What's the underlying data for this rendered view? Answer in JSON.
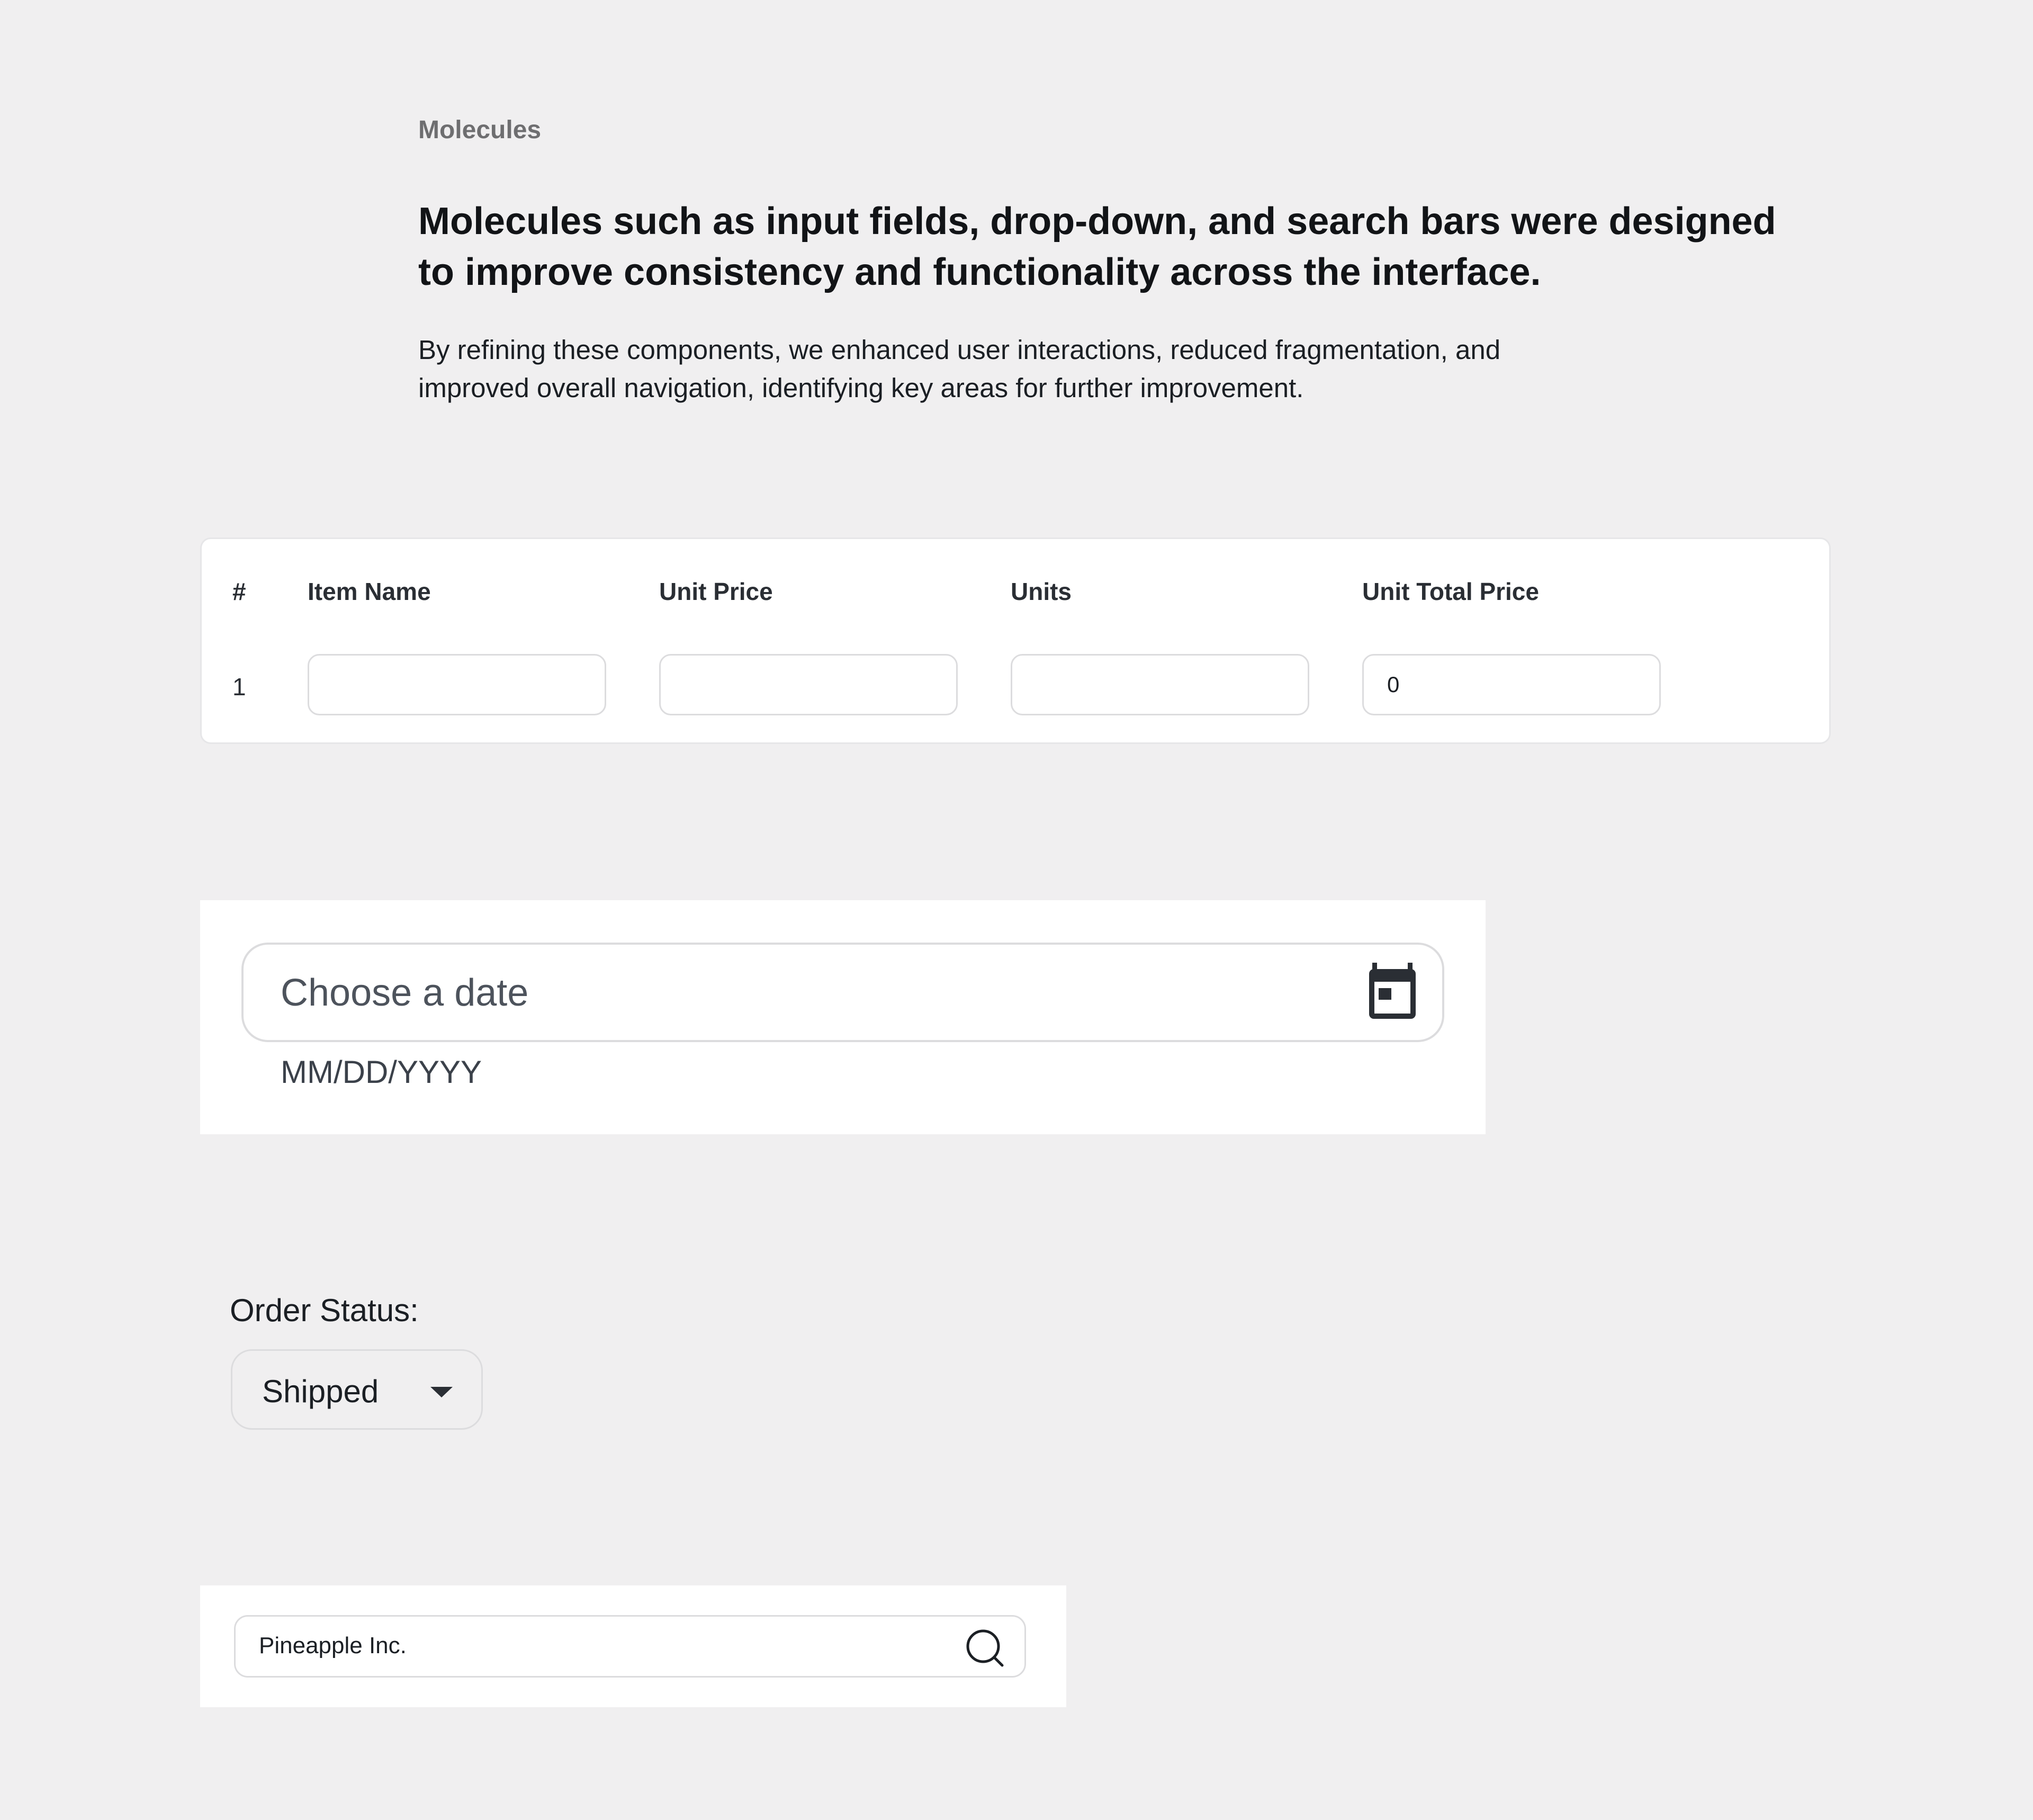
{
  "section": {
    "label": "Molecules",
    "headline": "Molecules such as input fields, drop-down, and search bars were designed to improve consistency and functionality across the interface.",
    "body": "By refining these components, we enhanced user interactions, reduced fragmentation, and improved overall navigation, identifying key areas for further improvement."
  },
  "table": {
    "headers": [
      "#",
      "Item Name",
      "Unit Price",
      "Units",
      "Unit Total Price"
    ],
    "rows": [
      {
        "number": "1",
        "item_name": "",
        "unit_price": "",
        "units": "",
        "unit_total_price": "0"
      }
    ]
  },
  "date_picker": {
    "placeholder": "Choose a date",
    "helper": "MM/DD/YYYY",
    "icon": "calendar-icon"
  },
  "order_status": {
    "label": "Order Status:",
    "selected": "Shipped",
    "icon": "chevron-down-icon"
  },
  "search": {
    "value": "Pineapple Inc.",
    "icon": "search-icon"
  },
  "colors": {
    "background": "#f0eff0",
    "card": "#ffffff",
    "border": "#dcdcde",
    "text": "#1b1f24",
    "muted": "#6e6e70"
  }
}
